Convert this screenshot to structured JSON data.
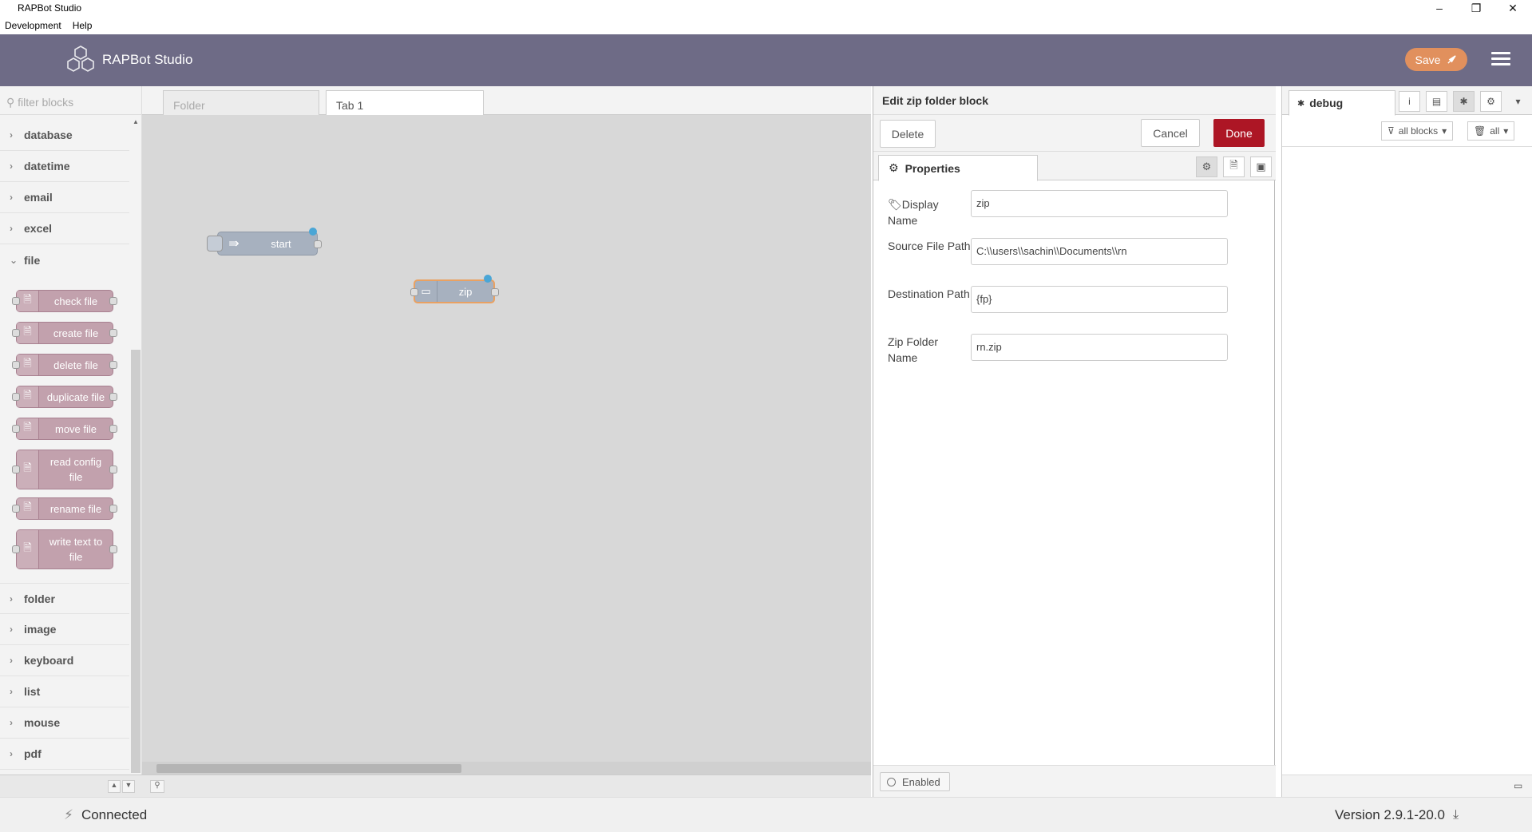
{
  "window": {
    "title": "RAPBot Studio",
    "minimize": "–",
    "restore": "❐",
    "close": "✕"
  },
  "menu": [
    "Development",
    "Help"
  ],
  "header": {
    "brand": "RAPBot Studio",
    "save_label": "Save"
  },
  "palette": {
    "filter_placeholder": "filter blocks",
    "categories_top": [
      "database",
      "datetime",
      "email",
      "excel",
      "file"
    ],
    "file_nodes": [
      "check file",
      "create file",
      "delete file",
      "duplicate file",
      "move file",
      "read config file",
      "rename file",
      "write text to file"
    ],
    "categories_bottom": [
      "folder",
      "image",
      "keyboard",
      "list",
      "mouse",
      "pdf"
    ]
  },
  "workspace": {
    "tabs": [
      "Folder",
      "Tab 1"
    ],
    "active_tab": "Tab 1",
    "nodes": [
      {
        "label": "start"
      },
      {
        "label": "zip"
      }
    ]
  },
  "editor": {
    "title": "Edit zip folder block",
    "delete_label": "Delete",
    "cancel_label": "Cancel",
    "done_label": "Done",
    "properties_tab": "Properties",
    "fields": {
      "display_name_label": "Display Name",
      "display_name_value": "zip",
      "source_label": "Source File Path",
      "source_value": "C:\\\\users\\\\sachin\\\\Documents\\\\rn",
      "dest_label": "Destination Path",
      "dest_value": "{fp}",
      "zipname_label": "Zip Folder Name",
      "zipname_value": "rn.zip"
    },
    "enabled_label": "Enabled"
  },
  "sidebar": {
    "tab": "debug",
    "filter_label": "all blocks",
    "clear_label": "all"
  },
  "status": {
    "connection": "Connected",
    "version": "Version 2.9.1-20.0"
  },
  "colors": {
    "header": "#6e6b86",
    "save": "#e1905d",
    "done": "#ad1625",
    "file_node": "#c2a1ad",
    "flow_node": "#a7b1bf",
    "port_active": "#4aa6d6"
  }
}
